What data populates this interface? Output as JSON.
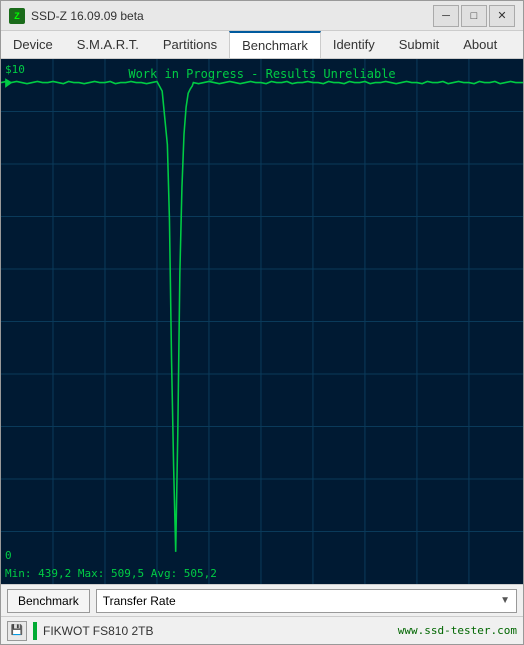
{
  "window": {
    "title": "SSD-Z 16.09.09 beta",
    "icon": "Z"
  },
  "titlebar": {
    "minimize_label": "─",
    "maximize_label": "□",
    "close_label": "✕"
  },
  "menu": {
    "items": [
      {
        "label": "Device",
        "active": false
      },
      {
        "label": "S.M.A.R.T.",
        "active": false
      },
      {
        "label": "Partitions",
        "active": false
      },
      {
        "label": "Benchmark",
        "active": true
      },
      {
        "label": "Identify",
        "active": false
      },
      {
        "label": "Submit",
        "active": false
      },
      {
        "label": "About",
        "active": false
      }
    ]
  },
  "chart": {
    "y_max": "$10",
    "y_min": "0",
    "watermark": "Work in Progress - Results Unreliable",
    "stats": "Min: 439,2  Max: 509,5  Avg: 505,2",
    "grid_color": "#0a3a5a",
    "line_color": "#00cc44",
    "bg_color": "#001a33"
  },
  "controls": {
    "benchmark_label": "Benchmark",
    "transfer_rate_label": "Transfer Rate",
    "dropdown_arrow": "▼"
  },
  "statusbar": {
    "drive_name": "FIKWOT FS810 2TB",
    "website": "www.ssd-tester.com"
  }
}
